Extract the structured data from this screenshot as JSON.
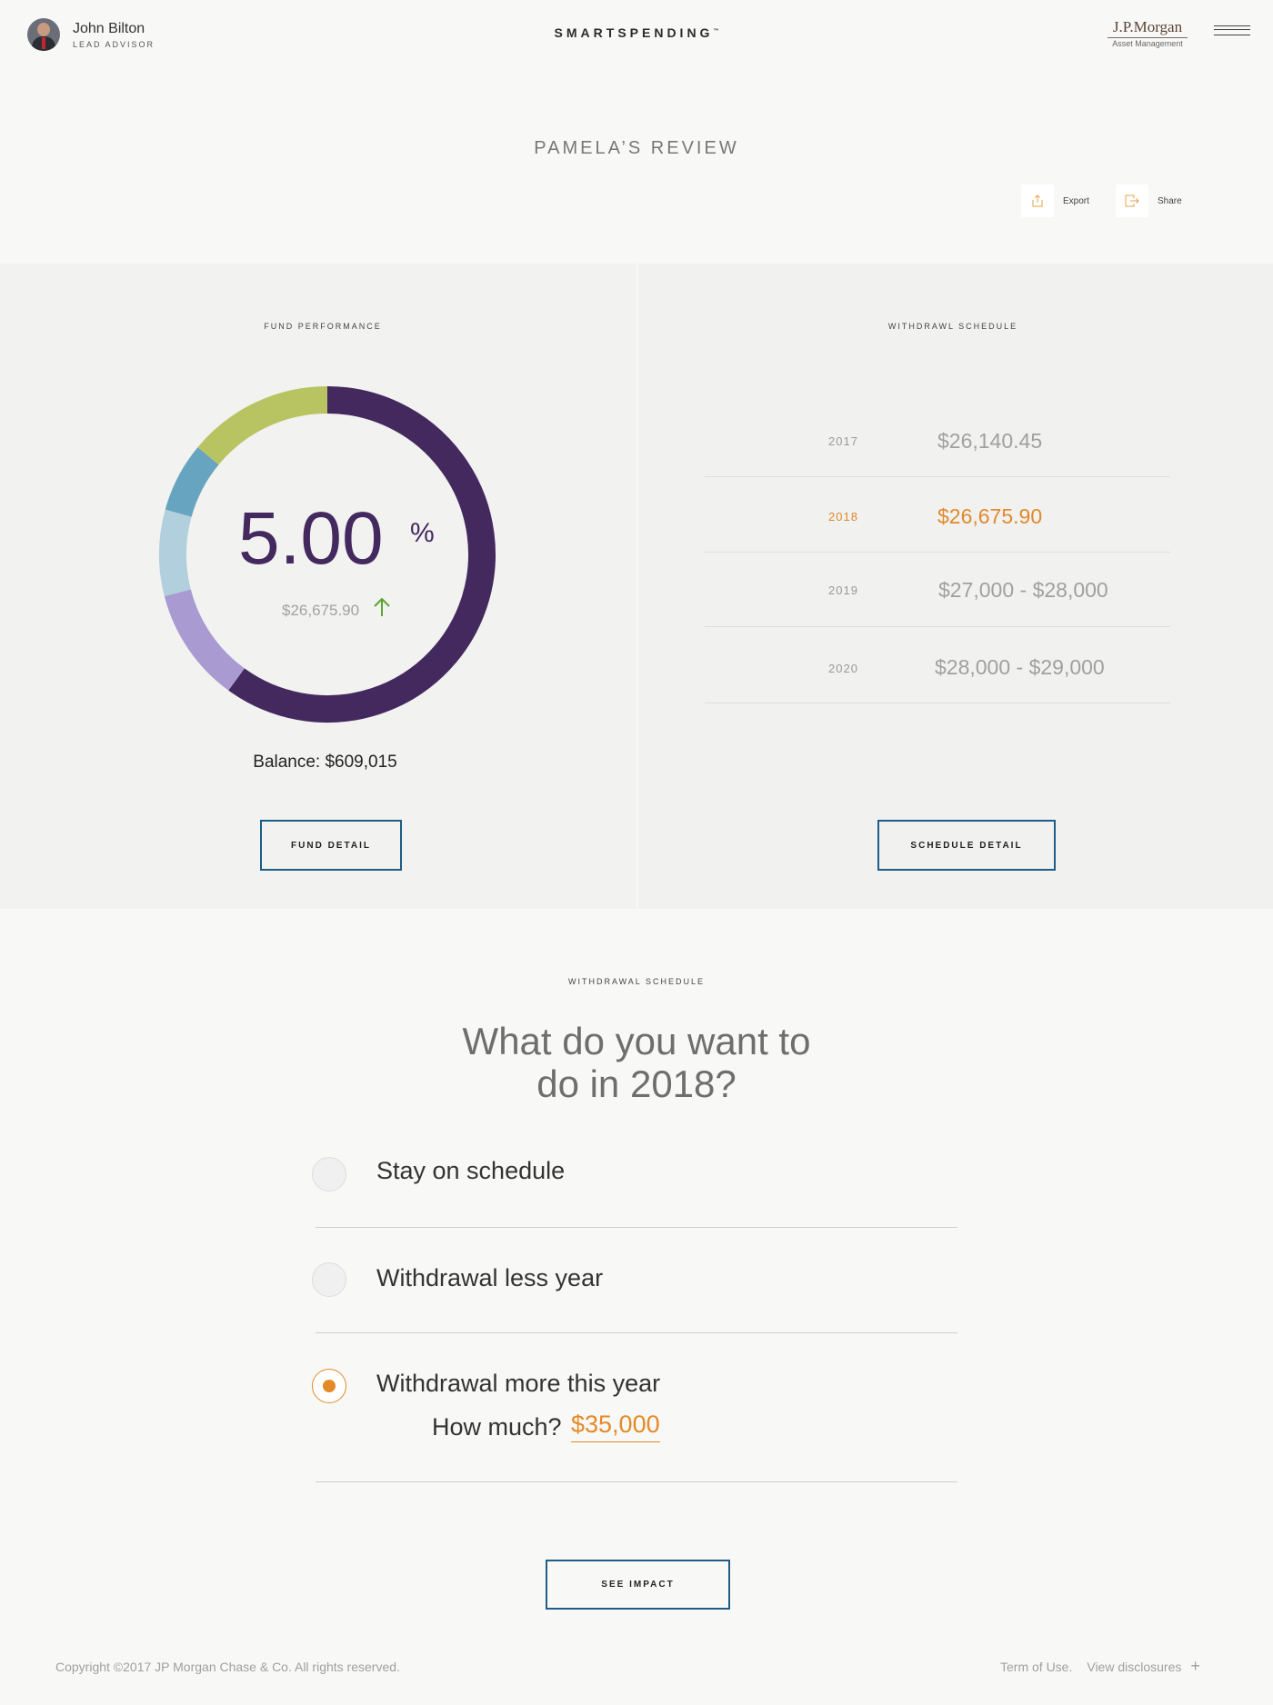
{
  "header": {
    "advisor_name": "John Bilton",
    "advisor_role": "LEAD ADVISOR",
    "brand": "SMARTSPENDING",
    "brand_tm": "™",
    "jpm_name": "J.P.Morgan",
    "jpm_sub": "Asset Management",
    "menu_icon": "hamburger-menu-icon"
  },
  "title": "PAMELA’S REVIEW",
  "actions": {
    "export": {
      "label": "Export",
      "icon": "export-icon"
    },
    "share": {
      "label": "Share",
      "icon": "share-icon"
    }
  },
  "fund": {
    "label": "FUND PERFORMANCE",
    "percent": "5.00",
    "percent_sign": "%",
    "amount": "$26,675.90",
    "trend": "up",
    "balance": "Balance: $609,015",
    "button": "FUND DETAIL",
    "segments": [
      {
        "color": "#43295e",
        "value": 60
      },
      {
        "color": "#a99bd1",
        "value": 11
      },
      {
        "color": "#b1cfdc",
        "value": 8.3
      },
      {
        "color": "#67a4bf",
        "value": 6.7
      },
      {
        "color": "#b8c461",
        "value": 14
      }
    ]
  },
  "schedule": {
    "label": "WITHDRAWL SCHEDULE",
    "rows": [
      {
        "year": "2017",
        "amount": "$26,140.45",
        "active": false
      },
      {
        "year": "2018",
        "amount": "$26,675.90",
        "active": true
      },
      {
        "year": "2019",
        "amount": "$27,000 - $28,000",
        "active": false
      },
      {
        "year": "2020",
        "amount": "$28,000 - $29,000",
        "active": false
      }
    ],
    "button": "SCHEDULE DETAIL"
  },
  "question": {
    "label": "WITHDRAWAL SCHEDULE",
    "title_line1": "What do you want to",
    "title_line2": "do in 2018?",
    "options": [
      {
        "label": "Stay on schedule",
        "checked": false
      },
      {
        "label": "Withdrawal less year",
        "checked": false
      },
      {
        "label": "Withdrawal more this year",
        "checked": true
      }
    ],
    "how_much_label": "How much?",
    "how_much_value": "$35,000",
    "button": "SEE IMPACT"
  },
  "colors": {
    "accent_orange": "#e38a27",
    "brand_purple": "#43295e",
    "button_border": "#1e5d88",
    "trend_green": "#5aa52e"
  },
  "footer": {
    "copyright": "Copyright ©2017  JP Morgan Chase & Co. All rights reserved.",
    "terms": "Term of Use.",
    "disclosures": "View disclosures"
  }
}
